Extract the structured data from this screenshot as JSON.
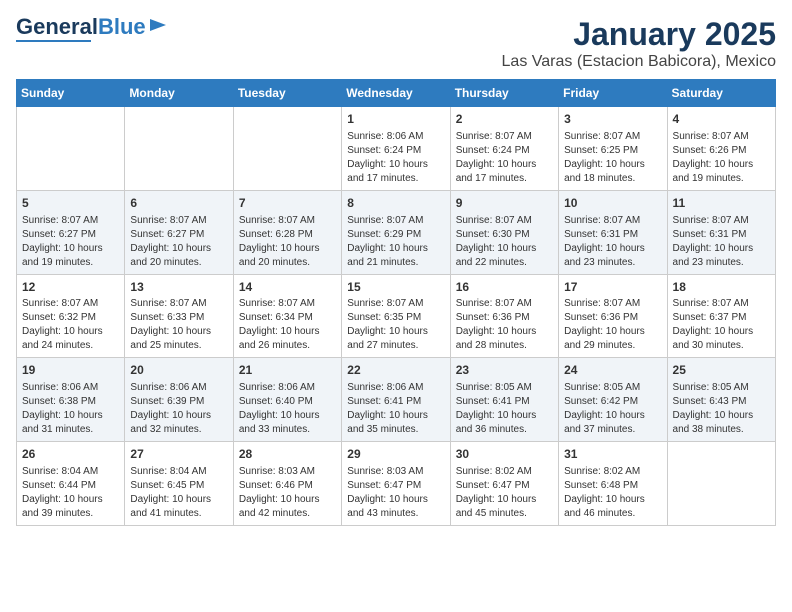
{
  "logo": {
    "part1": "General",
    "part2": "Blue"
  },
  "title": "January 2025",
  "subtitle": "Las Varas (Estacion Babicora), Mexico",
  "headers": [
    "Sunday",
    "Monday",
    "Tuesday",
    "Wednesday",
    "Thursday",
    "Friday",
    "Saturday"
  ],
  "weeks": [
    [
      {
        "day": "",
        "info": ""
      },
      {
        "day": "",
        "info": ""
      },
      {
        "day": "",
        "info": ""
      },
      {
        "day": "1",
        "info": "Sunrise: 8:06 AM\nSunset: 6:24 PM\nDaylight: 10 hours\nand 17 minutes."
      },
      {
        "day": "2",
        "info": "Sunrise: 8:07 AM\nSunset: 6:24 PM\nDaylight: 10 hours\nand 17 minutes."
      },
      {
        "day": "3",
        "info": "Sunrise: 8:07 AM\nSunset: 6:25 PM\nDaylight: 10 hours\nand 18 minutes."
      },
      {
        "day": "4",
        "info": "Sunrise: 8:07 AM\nSunset: 6:26 PM\nDaylight: 10 hours\nand 19 minutes."
      }
    ],
    [
      {
        "day": "5",
        "info": "Sunrise: 8:07 AM\nSunset: 6:27 PM\nDaylight: 10 hours\nand 19 minutes."
      },
      {
        "day": "6",
        "info": "Sunrise: 8:07 AM\nSunset: 6:27 PM\nDaylight: 10 hours\nand 20 minutes."
      },
      {
        "day": "7",
        "info": "Sunrise: 8:07 AM\nSunset: 6:28 PM\nDaylight: 10 hours\nand 20 minutes."
      },
      {
        "day": "8",
        "info": "Sunrise: 8:07 AM\nSunset: 6:29 PM\nDaylight: 10 hours\nand 21 minutes."
      },
      {
        "day": "9",
        "info": "Sunrise: 8:07 AM\nSunset: 6:30 PM\nDaylight: 10 hours\nand 22 minutes."
      },
      {
        "day": "10",
        "info": "Sunrise: 8:07 AM\nSunset: 6:31 PM\nDaylight: 10 hours\nand 23 minutes."
      },
      {
        "day": "11",
        "info": "Sunrise: 8:07 AM\nSunset: 6:31 PM\nDaylight: 10 hours\nand 23 minutes."
      }
    ],
    [
      {
        "day": "12",
        "info": "Sunrise: 8:07 AM\nSunset: 6:32 PM\nDaylight: 10 hours\nand 24 minutes."
      },
      {
        "day": "13",
        "info": "Sunrise: 8:07 AM\nSunset: 6:33 PM\nDaylight: 10 hours\nand 25 minutes."
      },
      {
        "day": "14",
        "info": "Sunrise: 8:07 AM\nSunset: 6:34 PM\nDaylight: 10 hours\nand 26 minutes."
      },
      {
        "day": "15",
        "info": "Sunrise: 8:07 AM\nSunset: 6:35 PM\nDaylight: 10 hours\nand 27 minutes."
      },
      {
        "day": "16",
        "info": "Sunrise: 8:07 AM\nSunset: 6:36 PM\nDaylight: 10 hours\nand 28 minutes."
      },
      {
        "day": "17",
        "info": "Sunrise: 8:07 AM\nSunset: 6:36 PM\nDaylight: 10 hours\nand 29 minutes."
      },
      {
        "day": "18",
        "info": "Sunrise: 8:07 AM\nSunset: 6:37 PM\nDaylight: 10 hours\nand 30 minutes."
      }
    ],
    [
      {
        "day": "19",
        "info": "Sunrise: 8:06 AM\nSunset: 6:38 PM\nDaylight: 10 hours\nand 31 minutes."
      },
      {
        "day": "20",
        "info": "Sunrise: 8:06 AM\nSunset: 6:39 PM\nDaylight: 10 hours\nand 32 minutes."
      },
      {
        "day": "21",
        "info": "Sunrise: 8:06 AM\nSunset: 6:40 PM\nDaylight: 10 hours\nand 33 minutes."
      },
      {
        "day": "22",
        "info": "Sunrise: 8:06 AM\nSunset: 6:41 PM\nDaylight: 10 hours\nand 35 minutes."
      },
      {
        "day": "23",
        "info": "Sunrise: 8:05 AM\nSunset: 6:41 PM\nDaylight: 10 hours\nand 36 minutes."
      },
      {
        "day": "24",
        "info": "Sunrise: 8:05 AM\nSunset: 6:42 PM\nDaylight: 10 hours\nand 37 minutes."
      },
      {
        "day": "25",
        "info": "Sunrise: 8:05 AM\nSunset: 6:43 PM\nDaylight: 10 hours\nand 38 minutes."
      }
    ],
    [
      {
        "day": "26",
        "info": "Sunrise: 8:04 AM\nSunset: 6:44 PM\nDaylight: 10 hours\nand 39 minutes."
      },
      {
        "day": "27",
        "info": "Sunrise: 8:04 AM\nSunset: 6:45 PM\nDaylight: 10 hours\nand 41 minutes."
      },
      {
        "day": "28",
        "info": "Sunrise: 8:03 AM\nSunset: 6:46 PM\nDaylight: 10 hours\nand 42 minutes."
      },
      {
        "day": "29",
        "info": "Sunrise: 8:03 AM\nSunset: 6:47 PM\nDaylight: 10 hours\nand 43 minutes."
      },
      {
        "day": "30",
        "info": "Sunrise: 8:02 AM\nSunset: 6:47 PM\nDaylight: 10 hours\nand 45 minutes."
      },
      {
        "day": "31",
        "info": "Sunrise: 8:02 AM\nSunset: 6:48 PM\nDaylight: 10 hours\nand 46 minutes."
      },
      {
        "day": "",
        "info": ""
      }
    ]
  ]
}
